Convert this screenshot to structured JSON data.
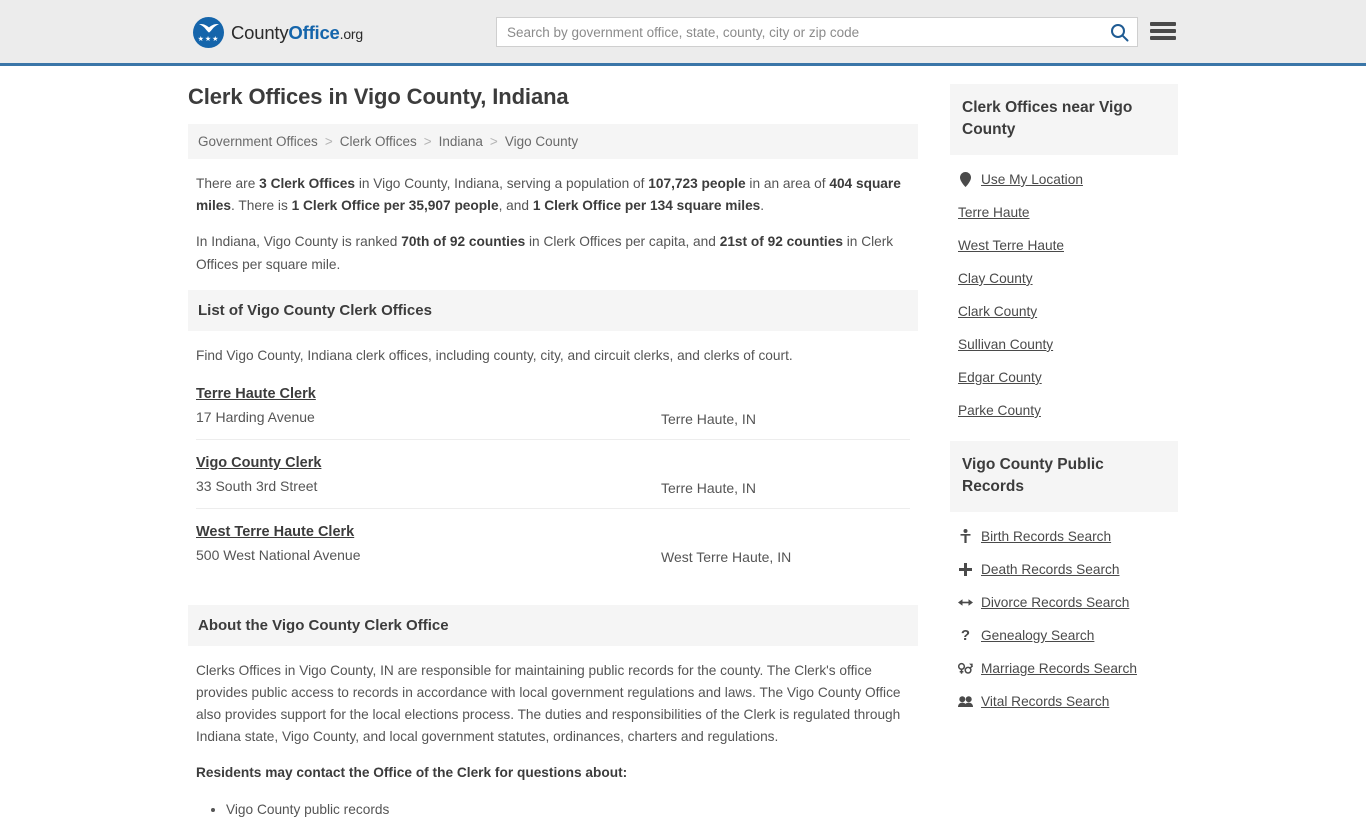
{
  "header": {
    "logo": {
      "part1": "County",
      "part2": "Office",
      "part3": ".org",
      "icon": "eagle-shield-logo",
      "stars": "★★★"
    },
    "search": {
      "placeholder": "Search by government office, state, county, city or zip code",
      "value": "",
      "button_icon": "search-icon"
    },
    "menu_icon": "hamburger-menu-icon",
    "accent_color": "#3b76a8",
    "background_color": "#ececec"
  },
  "page": {
    "title": "Clerk Offices in Vigo County, Indiana"
  },
  "breadcrumb": {
    "separator": ">",
    "items": [
      {
        "label": "Government Offices"
      },
      {
        "label": "Clerk Offices"
      },
      {
        "label": "Indiana"
      },
      {
        "label": "Vigo County"
      }
    ]
  },
  "stats": {
    "paragraph1": {
      "p1": "There are ",
      "b1": "3 Clerk Offices",
      "p2": " in Vigo County, Indiana, serving a population of ",
      "b2": "107,723 people",
      "p3": " in an area of ",
      "b3": "404 square miles",
      "p4": ". There is ",
      "b4": "1 Clerk Office per 35,907 people",
      "p5": ", and ",
      "b5": "1 Clerk Office per 134 square miles",
      "p6": "."
    },
    "paragraph2": {
      "p1": "In Indiana, Vigo County is ranked ",
      "b1": "70th of 92 counties",
      "p2": " in Clerk Offices per capita, and ",
      "b2": "21st of 92 counties",
      "p3": " in Clerk Offices per square mile."
    }
  },
  "list_section": {
    "heading": "List of Vigo County Clerk Offices",
    "intro": "Find Vigo County, Indiana clerk offices, including county, city, and circuit clerks, and clerks of court.",
    "offices": [
      {
        "name": "Terre Haute Clerk",
        "address": "17 Harding Avenue",
        "city_state": "Terre Haute, IN"
      },
      {
        "name": "Vigo County Clerk",
        "address": "33 South 3rd Street",
        "city_state": "Terre Haute, IN"
      },
      {
        "name": "West Terre Haute Clerk",
        "address": "500 West National Avenue",
        "city_state": "West Terre Haute, IN"
      }
    ]
  },
  "about_section": {
    "heading": "About the Vigo County Clerk Office",
    "paragraph": "Clerks Offices in Vigo County, IN are responsible for maintaining public records for the county. The Clerk's office provides public access to records in accordance with local government regulations and laws. The Vigo County Office also provides support for the local elections process. The duties and responsibilities of the Clerk is regulated through Indiana state, Vigo County, and local government statutes, ordinances, charters and regulations.",
    "subheading": "Residents may contact the Office of the Clerk for questions about:",
    "bullets": [
      "Vigo County public records"
    ]
  },
  "sidebar": {
    "nearby_panel": {
      "heading": "Clerk Offices near Vigo County",
      "links": [
        {
          "label": "Use My Location",
          "icon": "map-pin-icon"
        },
        {
          "label": "Terre Haute",
          "icon": ""
        },
        {
          "label": "West Terre Haute",
          "icon": ""
        },
        {
          "label": "Clay County",
          "icon": ""
        },
        {
          "label": "Clark County",
          "icon": ""
        },
        {
          "label": "Sullivan County",
          "icon": ""
        },
        {
          "label": "Edgar County",
          "icon": ""
        },
        {
          "label": "Parke County",
          "icon": ""
        }
      ]
    },
    "records_panel": {
      "heading": "Vigo County Public Records",
      "links": [
        {
          "label": "Birth Records Search",
          "icon": "baby-icon",
          "glyph": "👶"
        },
        {
          "label": "Death Records Search",
          "icon": "cross-icon",
          "glyph": "✚"
        },
        {
          "label": "Divorce Records Search",
          "icon": "double-arrow-icon",
          "glyph": "↔"
        },
        {
          "label": "Genealogy Search",
          "icon": "question-mark-icon",
          "glyph": "❓"
        },
        {
          "label": "Marriage Records Search",
          "icon": "venus-mars-icon",
          "glyph": "⚥"
        },
        {
          "label": "Vital Records Search",
          "icon": "people-icon",
          "glyph": "👥"
        }
      ]
    }
  }
}
